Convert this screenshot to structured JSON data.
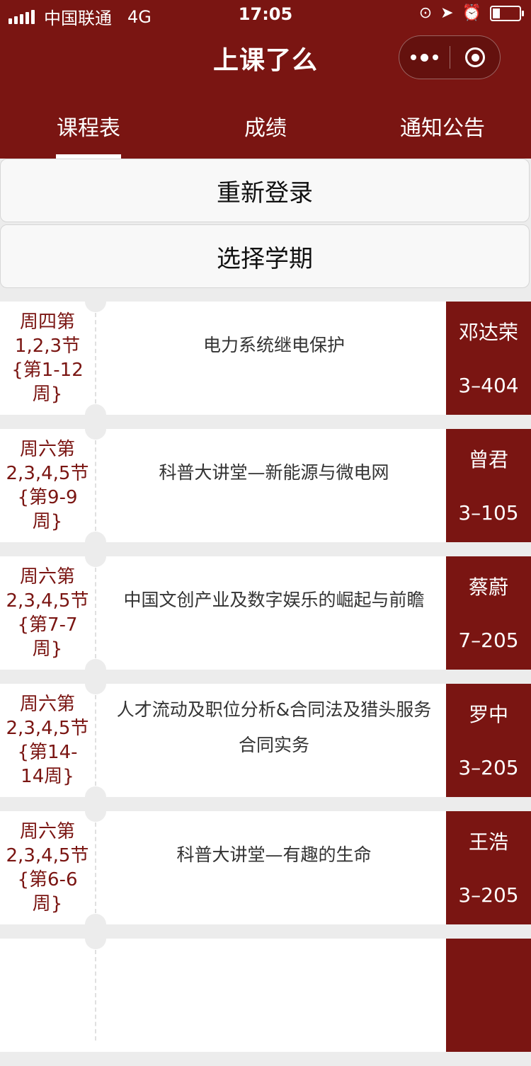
{
  "status_bar": {
    "carrier": "中国联通",
    "network": "4G",
    "time": "17:05"
  },
  "app": {
    "title": "上课了么"
  },
  "tabs": [
    {
      "label": "课程表",
      "active": true
    },
    {
      "label": "成绩",
      "active": false
    },
    {
      "label": "通知公告",
      "active": false
    }
  ],
  "actions": {
    "relogin": "重新登录",
    "select_term": "选择学期"
  },
  "courses": [
    {
      "when": "周四第1,2,3节{第1-12周}",
      "name": "电力系统继电保护",
      "teacher": "邓达荣",
      "room": "3–404"
    },
    {
      "when": "周六第2,3,4,5节{第9-9周}",
      "name": "科普大讲堂—新能源与微电网",
      "teacher": "曾君",
      "room": "3–105"
    },
    {
      "when": "周六第2,3,4,5节{第7-7周}",
      "name": "中国文创产业及数字娱乐的崛起与前瞻",
      "teacher": "蔡蔚",
      "room": "7–205"
    },
    {
      "when": "周六第2,3,4,5节{第14-14周}",
      "name": "人才流动及职位分析&合同法及猎头服务合同实务",
      "teacher": "罗中",
      "room": "3–205"
    },
    {
      "when": "周六第2,3,4,5节{第6-6周}",
      "name": "科普大讲堂—有趣的生命",
      "teacher": "王浩",
      "room": "3–205"
    }
  ],
  "colors": {
    "brand": "#7a1512",
    "background": "#ececec"
  },
  "icons": {
    "more": "more-dots-icon",
    "close": "capsule-close-icon",
    "lock": "rotation-lock-icon",
    "location": "location-arrow-icon",
    "alarm": "alarm-icon",
    "battery": "battery-icon",
    "signal": "signal-bars-icon"
  }
}
